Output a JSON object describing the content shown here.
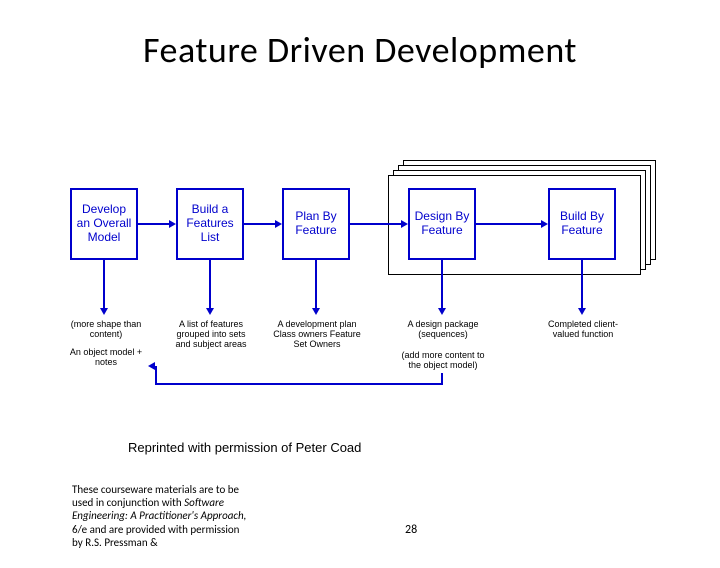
{
  "title": "Feature Driven Development",
  "boxes": [
    {
      "label": "Develop an Overall Model"
    },
    {
      "label": "Build a Features List"
    },
    {
      "label": "Plan By Feature"
    },
    {
      "label": "Design By Feature"
    },
    {
      "label": "Build By Feature"
    }
  ],
  "captions": {
    "c1a": "(more shape than content)",
    "c1b": "An object model + notes",
    "c2": "A list of features grouped into sets and subject areas",
    "c3": "A development plan Class owners Feature Set Owners",
    "c4a": "A design package (sequences)",
    "c4b": "(add more content to the object model)",
    "c5": "Completed client-valued function"
  },
  "permission": "Reprinted with permission of Peter Coad",
  "footer_a": "These courseware materials are to be used in conjunction with ",
  "footer_b": "Software Engineering: A Practitioner's Approach,",
  "footer_c": " 6/e and are provided with permission by R.S. Pressman &",
  "page": "28"
}
